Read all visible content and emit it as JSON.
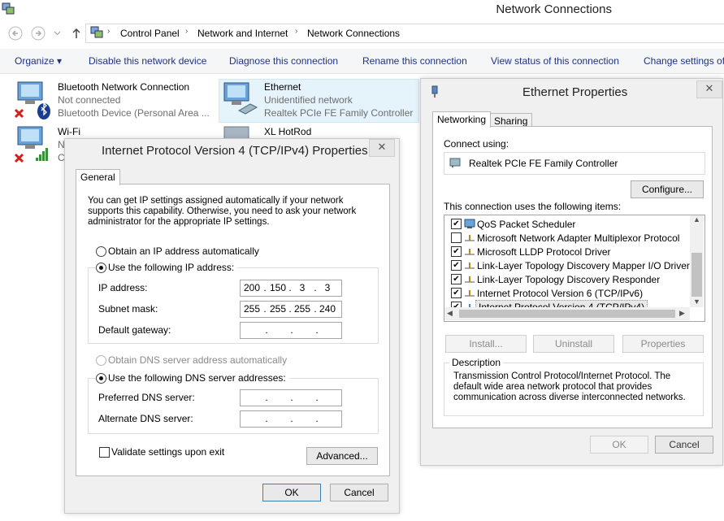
{
  "window": {
    "title": "Network Connections",
    "breadcrumb": [
      "Control Panel",
      "Network and Internet",
      "Network Connections"
    ],
    "toolbar": [
      "Organize ▾",
      "Disable this network device",
      "Diagnose this connection",
      "Rename this connection",
      "View status of this connection",
      "Change settings of"
    ]
  },
  "connections": [
    {
      "name": "Bluetooth Network Connection",
      "status": "Not connected",
      "device": "Bluetooth Device (Personal Area ..."
    },
    {
      "name": "Ethernet",
      "status": "Unidentified network",
      "device": "Realtek PCIe FE Family Controller"
    },
    {
      "name": "Wi-Fi",
      "status": "N",
      "device": "C"
    },
    {
      "name": "XL HotRod",
      "status": "",
      "device": ""
    }
  ],
  "ipv4": {
    "title": "Internet Protocol Version 4 (TCP/IPv4) Properties",
    "tab": "General",
    "intro": "You can get IP settings assigned automatically if your network supports this capability. Otherwise, you need to ask your network administrator for the appropriate IP settings.",
    "radio_auto_ip": "Obtain an IP address automatically",
    "radio_manual_ip": "Use the following IP address:",
    "ip_label": "IP address:",
    "ip_value": [
      "200",
      "150",
      "3",
      "3"
    ],
    "mask_label": "Subnet mask:",
    "mask_value": [
      "255",
      "255",
      "255",
      "240"
    ],
    "gateway_label": "Default gateway:",
    "radio_auto_dns": "Obtain DNS server address automatically",
    "radio_manual_dns": "Use the following DNS server addresses:",
    "pref_dns_label": "Preferred DNS server:",
    "alt_dns_label": "Alternate DNS server:",
    "validate_label": "Validate settings upon exit",
    "advanced_button": "Advanced...",
    "ok_button": "OK",
    "cancel_button": "Cancel"
  },
  "eth": {
    "title": "Ethernet Properties",
    "tabs": [
      "Networking",
      "Sharing"
    ],
    "connect_using_label": "Connect using:",
    "adapter": "Realtek PCIe FE Family Controller",
    "configure_button": "Configure...",
    "items_label": "This connection uses the following items:",
    "items": [
      {
        "label": "QoS Packet Scheduler",
        "checked": true
      },
      {
        "label": "Microsoft Network Adapter Multiplexor Protocol",
        "checked": false
      },
      {
        "label": "Microsoft LLDP Protocol Driver",
        "checked": true
      },
      {
        "label": "Link-Layer Topology Discovery Mapper I/O Driver",
        "checked": true
      },
      {
        "label": "Link-Layer Topology Discovery Responder",
        "checked": true
      },
      {
        "label": "Internet Protocol Version 6 (TCP/IPv6)",
        "checked": true
      },
      {
        "label": "Internet Protocol Version 4 (TCP/IPv4)",
        "checked": true
      }
    ],
    "install_button": "Install...",
    "uninstall_button": "Uninstall",
    "properties_button": "Properties",
    "description_label": "Description",
    "description_text": "Transmission Control Protocol/Internet Protocol. The default wide area network protocol that provides communication across diverse interconnected networks.",
    "ok_button": "OK",
    "cancel_button": "Cancel"
  },
  "colors": {
    "link": "#1e3287",
    "selection": "#e5f3fb",
    "error_red": "#d0201d"
  }
}
